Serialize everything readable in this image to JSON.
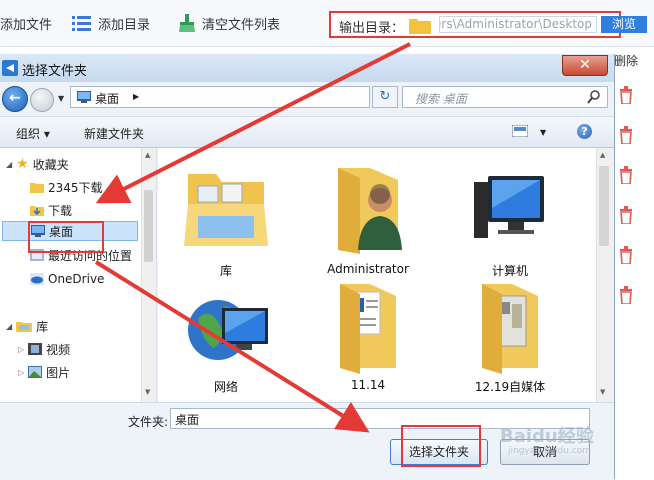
{
  "toolbar": {
    "add_file_label": "添加文件",
    "add_folder_label": "添加目录",
    "clear_list_label": "清空文件列表",
    "output_label": "输出目录：",
    "output_path": "ers\\Administrator\\Desktop",
    "browse_label": "浏览"
  },
  "list": {
    "delete_header": "删除"
  },
  "dialog": {
    "title": "选择文件夹",
    "close_glyph": "✕",
    "address": "桌面",
    "search_placeholder": "搜索 桌面",
    "organize_label": "组织 ▾",
    "new_folder_label": "新建文件夹",
    "help_glyph": "?",
    "nav": {
      "favorites": "收藏夹",
      "items": [
        "2345下载",
        "下载",
        "桌面",
        "最近访问的位置",
        "OneDrive"
      ],
      "libraries": "库",
      "lib_items": [
        "视频",
        "图片"
      ]
    },
    "files": [
      "库",
      "Administrator",
      "计算机",
      "网络",
      "11.14",
      "12.19自媒体"
    ],
    "folder_field_label": "文件夹:",
    "folder_field_value": "桌面",
    "select_button": "选择文件夹",
    "cancel_button": "取消"
  },
  "watermark": {
    "main": "Baidu经验",
    "sub": "jingyan.baidu.com"
  },
  "colors": {
    "highlight": "#e53935",
    "accent": "#2f7fe0"
  }
}
